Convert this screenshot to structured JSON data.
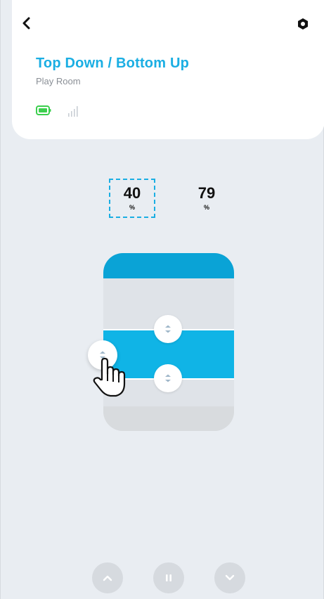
{
  "header": {
    "title": "Top Down / Bottom Up",
    "room": "Play Room",
    "icons": {
      "back": "chevron-left-icon",
      "settings": "gear-icon",
      "battery": "battery-icon",
      "signal": "signal-bars-icon"
    }
  },
  "positions": {
    "top": {
      "value": "40",
      "unit": "%"
    },
    "bottom": {
      "value": "79",
      "unit": "%"
    }
  },
  "shade": {
    "top_position_percent": 40,
    "bottom_position_percent": 79,
    "colors": {
      "headrail": "#0aa3d6",
      "fabric": "#10b4e6",
      "track": "#dfe3e8"
    }
  },
  "controls": [
    "open-up-button",
    "stop-button",
    "close-down-button"
  ],
  "colors": {
    "accent": "#1aaee3",
    "battery": "#3ccf4e"
  }
}
